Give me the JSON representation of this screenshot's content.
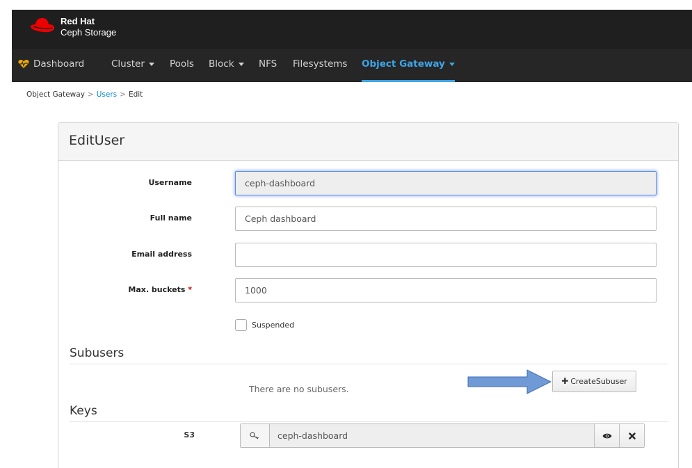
{
  "brand": {
    "line1": "Red Hat",
    "line2": "Ceph Storage",
    "logo": "red-hat-logo",
    "color": "#ee0000"
  },
  "nav": {
    "items": [
      {
        "label": "Dashboard",
        "icon": "heart-pulse-icon"
      },
      {
        "label": "Cluster",
        "dropdown": true
      },
      {
        "label": "Pools"
      },
      {
        "label": "Block",
        "dropdown": true
      },
      {
        "label": "NFS"
      },
      {
        "label": "Filesystems"
      },
      {
        "label": "Object Gateway",
        "dropdown": true,
        "active": true
      }
    ],
    "active_color": "#3ea4e6"
  },
  "breadcrumb": {
    "root": "Object Gateway",
    "parent": "Users",
    "current": "Edit",
    "separator": ">"
  },
  "form": {
    "title": "EditUser",
    "username": {
      "label": "Username",
      "value": "ceph-dashboard"
    },
    "fullname": {
      "label": "Full name",
      "value": "Ceph dashboard"
    },
    "email": {
      "label": "Email address",
      "value": ""
    },
    "max_buckets": {
      "label": "Max. buckets",
      "required_mark": "*",
      "value": "1000"
    },
    "suspended": {
      "label": "Suspended",
      "checked": false
    }
  },
  "subusers": {
    "title": "Subusers",
    "empty_text": "There are no subusers.",
    "create_button": "CreateSubuser",
    "create_icon": "plus-icon"
  },
  "keys": {
    "title": "Keys",
    "s3": {
      "label": "S3",
      "value": "ceph-dashboard",
      "key_icon": "key-icon",
      "show_icon": "eye-icon",
      "delete_icon": "close-icon"
    }
  }
}
